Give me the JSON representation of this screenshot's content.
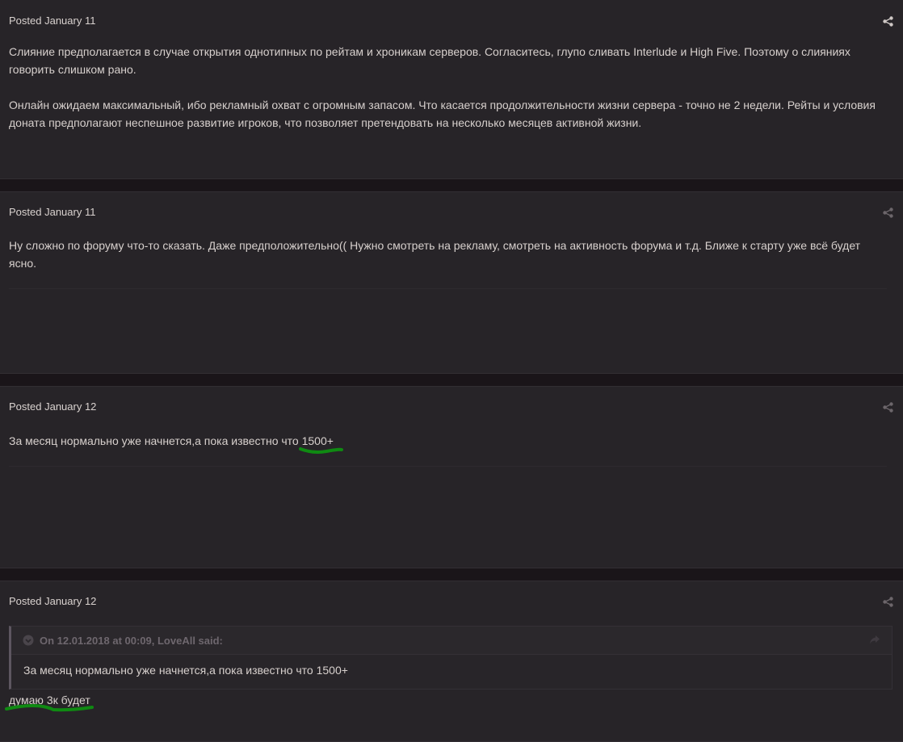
{
  "posts": [
    {
      "meta": "Posted January 11",
      "paragraphs": [
        "Слияние предполагается в случае открытия однотипных по рейтам и хроникам серверов. Согласитесь, глупо сливать Interlude и High Five. Поэтому о слияниях говорить слишком рано.",
        "Онлайн ожидаем максимальный, ибо рекламный охват с огромным запасом. Что касается продолжительности жизни сервера - точно не 2 недели. Рейты и условия доната предполагают неспешное развитие игроков, что позволяет претендовать на несколько месяцев активной жизни."
      ]
    },
    {
      "meta": "Posted January 11",
      "paragraphs": [
        "Ну сложно по форуму что-то сказать. Даже предположительно(( Нужно смотреть на рекламу, смотреть на активность форума и т.д. Ближе к старту уже всё будет ясно."
      ]
    },
    {
      "meta": "Posted January 12",
      "text_before": "За месяц нормально уже начнется,а пока известно что ",
      "highlight": "1500+"
    },
    {
      "meta": "Posted January 12",
      "quote": {
        "citation": "On 12.01.2018 at 00:09, LoveAll said:",
        "text": "За месяц нормально уже начнется,а пока известно что 1500+"
      },
      "reply": "думаю 3к будет"
    }
  ],
  "icons": {
    "share": "share-icon",
    "quote_toggle": "chevron-circle-icon",
    "quote_jump": "share-arrow-icon"
  },
  "colors": {
    "page_bg": "#1a1519",
    "post_bg": "#272428",
    "text": "#d7d0cd",
    "highlight_underline": "#0f8a12"
  }
}
